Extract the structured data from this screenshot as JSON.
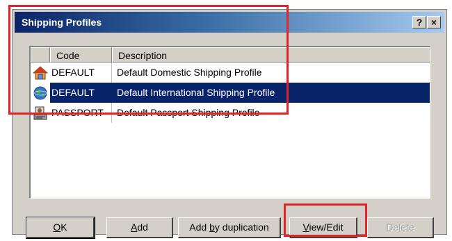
{
  "dialog": {
    "title": "Shipping Profiles",
    "help_label": "?",
    "close_label": "×"
  },
  "columns": {
    "code": "Code",
    "description": "Description"
  },
  "profiles": [
    {
      "code": "DEFAULT",
      "description": "Default Domestic Shipping Profile",
      "icon": "house-icon",
      "selected": false
    },
    {
      "code": "DEFAULT",
      "description": "Default International Shipping Profile",
      "icon": "globe-icon",
      "selected": true
    },
    {
      "code": "PASSPORT",
      "description": "Default Passport Shipping Profile",
      "icon": "passport-icon",
      "selected": false
    }
  ],
  "buttons": {
    "ok": {
      "mnemonic": "O",
      "rest": "K"
    },
    "add": {
      "mnemonic": "A",
      "rest": "dd"
    },
    "add_dup": {
      "pre": "Add ",
      "mnemonic": "b",
      "rest": "y duplication"
    },
    "view_edit": {
      "mnemonic": "V",
      "rest": "iew/Edit"
    },
    "delete": "Delete"
  },
  "colors": {
    "selection": "#0a246a",
    "annotation": "#e0242c",
    "dialog_face": "#d4d0c8"
  }
}
